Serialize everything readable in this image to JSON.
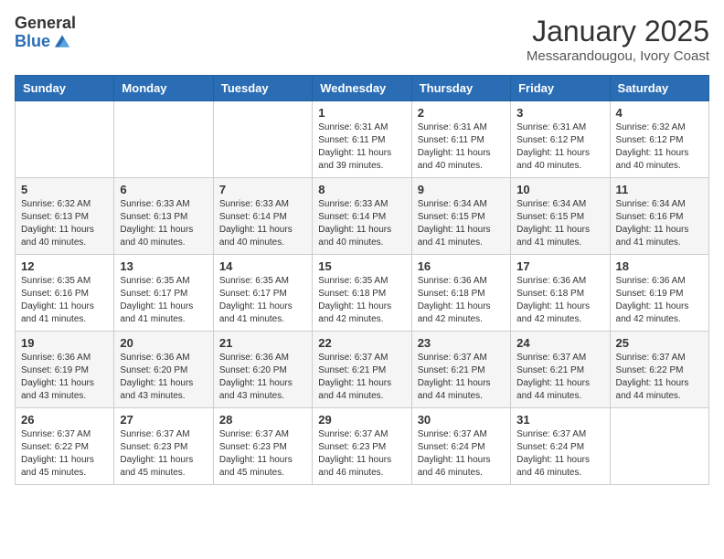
{
  "logo": {
    "general": "General",
    "blue": "Blue"
  },
  "header": {
    "month": "January 2025",
    "location": "Messarandougou, Ivory Coast"
  },
  "weekdays": [
    "Sunday",
    "Monday",
    "Tuesday",
    "Wednesday",
    "Thursday",
    "Friday",
    "Saturday"
  ],
  "weeks": [
    [
      {
        "day": "",
        "info": ""
      },
      {
        "day": "",
        "info": ""
      },
      {
        "day": "",
        "info": ""
      },
      {
        "day": "1",
        "info": "Sunrise: 6:31 AM\nSunset: 6:11 PM\nDaylight: 11 hours and 39 minutes."
      },
      {
        "day": "2",
        "info": "Sunrise: 6:31 AM\nSunset: 6:11 PM\nDaylight: 11 hours and 40 minutes."
      },
      {
        "day": "3",
        "info": "Sunrise: 6:31 AM\nSunset: 6:12 PM\nDaylight: 11 hours and 40 minutes."
      },
      {
        "day": "4",
        "info": "Sunrise: 6:32 AM\nSunset: 6:12 PM\nDaylight: 11 hours and 40 minutes."
      }
    ],
    [
      {
        "day": "5",
        "info": "Sunrise: 6:32 AM\nSunset: 6:13 PM\nDaylight: 11 hours and 40 minutes."
      },
      {
        "day": "6",
        "info": "Sunrise: 6:33 AM\nSunset: 6:13 PM\nDaylight: 11 hours and 40 minutes."
      },
      {
        "day": "7",
        "info": "Sunrise: 6:33 AM\nSunset: 6:14 PM\nDaylight: 11 hours and 40 minutes."
      },
      {
        "day": "8",
        "info": "Sunrise: 6:33 AM\nSunset: 6:14 PM\nDaylight: 11 hours and 40 minutes."
      },
      {
        "day": "9",
        "info": "Sunrise: 6:34 AM\nSunset: 6:15 PM\nDaylight: 11 hours and 41 minutes."
      },
      {
        "day": "10",
        "info": "Sunrise: 6:34 AM\nSunset: 6:15 PM\nDaylight: 11 hours and 41 minutes."
      },
      {
        "day": "11",
        "info": "Sunrise: 6:34 AM\nSunset: 6:16 PM\nDaylight: 11 hours and 41 minutes."
      }
    ],
    [
      {
        "day": "12",
        "info": "Sunrise: 6:35 AM\nSunset: 6:16 PM\nDaylight: 11 hours and 41 minutes."
      },
      {
        "day": "13",
        "info": "Sunrise: 6:35 AM\nSunset: 6:17 PM\nDaylight: 11 hours and 41 minutes."
      },
      {
        "day": "14",
        "info": "Sunrise: 6:35 AM\nSunset: 6:17 PM\nDaylight: 11 hours and 41 minutes."
      },
      {
        "day": "15",
        "info": "Sunrise: 6:35 AM\nSunset: 6:18 PM\nDaylight: 11 hours and 42 minutes."
      },
      {
        "day": "16",
        "info": "Sunrise: 6:36 AM\nSunset: 6:18 PM\nDaylight: 11 hours and 42 minutes."
      },
      {
        "day": "17",
        "info": "Sunrise: 6:36 AM\nSunset: 6:18 PM\nDaylight: 11 hours and 42 minutes."
      },
      {
        "day": "18",
        "info": "Sunrise: 6:36 AM\nSunset: 6:19 PM\nDaylight: 11 hours and 42 minutes."
      }
    ],
    [
      {
        "day": "19",
        "info": "Sunrise: 6:36 AM\nSunset: 6:19 PM\nDaylight: 11 hours and 43 minutes."
      },
      {
        "day": "20",
        "info": "Sunrise: 6:36 AM\nSunset: 6:20 PM\nDaylight: 11 hours and 43 minutes."
      },
      {
        "day": "21",
        "info": "Sunrise: 6:36 AM\nSunset: 6:20 PM\nDaylight: 11 hours and 43 minutes."
      },
      {
        "day": "22",
        "info": "Sunrise: 6:37 AM\nSunset: 6:21 PM\nDaylight: 11 hours and 44 minutes."
      },
      {
        "day": "23",
        "info": "Sunrise: 6:37 AM\nSunset: 6:21 PM\nDaylight: 11 hours and 44 minutes."
      },
      {
        "day": "24",
        "info": "Sunrise: 6:37 AM\nSunset: 6:21 PM\nDaylight: 11 hours and 44 minutes."
      },
      {
        "day": "25",
        "info": "Sunrise: 6:37 AM\nSunset: 6:22 PM\nDaylight: 11 hours and 44 minutes."
      }
    ],
    [
      {
        "day": "26",
        "info": "Sunrise: 6:37 AM\nSunset: 6:22 PM\nDaylight: 11 hours and 45 minutes."
      },
      {
        "day": "27",
        "info": "Sunrise: 6:37 AM\nSunset: 6:23 PM\nDaylight: 11 hours and 45 minutes."
      },
      {
        "day": "28",
        "info": "Sunrise: 6:37 AM\nSunset: 6:23 PM\nDaylight: 11 hours and 45 minutes."
      },
      {
        "day": "29",
        "info": "Sunrise: 6:37 AM\nSunset: 6:23 PM\nDaylight: 11 hours and 46 minutes."
      },
      {
        "day": "30",
        "info": "Sunrise: 6:37 AM\nSunset: 6:24 PM\nDaylight: 11 hours and 46 minutes."
      },
      {
        "day": "31",
        "info": "Sunrise: 6:37 AM\nSunset: 6:24 PM\nDaylight: 11 hours and 46 minutes."
      },
      {
        "day": "",
        "info": ""
      }
    ]
  ]
}
